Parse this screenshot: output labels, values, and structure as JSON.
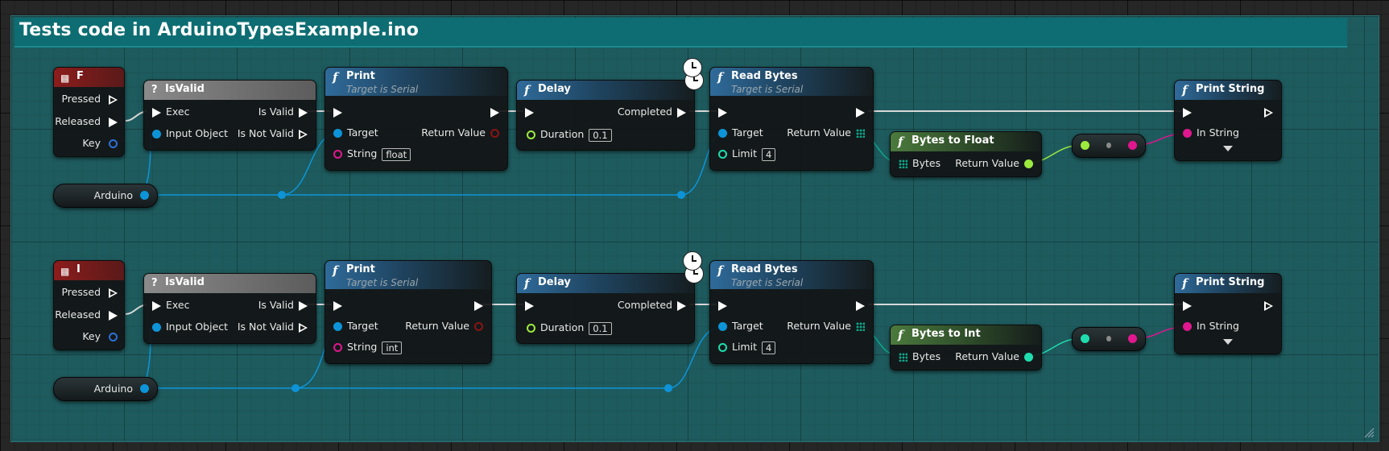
{
  "comment": {
    "title": "Tests code in ArduinoTypesExample.ino"
  },
  "rows": [
    {
      "event": {
        "title": "F",
        "pressed": "Pressed",
        "released": "Released",
        "key": "Key"
      },
      "isvalid": {
        "title": "IsValid",
        "exec": "Exec",
        "input_object": "Input Object",
        "is_valid": "Is Valid",
        "is_not_valid": "Is Not Valid"
      },
      "variable": {
        "name": "Arduino"
      },
      "print": {
        "title": "Print",
        "subtitle": "Target is Serial",
        "target": "Target",
        "return_value": "Return Value",
        "string_label": "String",
        "string_value": "float"
      },
      "delay": {
        "title": "Delay",
        "completed": "Completed",
        "duration_label": "Duration",
        "duration_value": "0.1"
      },
      "read_bytes": {
        "title": "Read Bytes",
        "subtitle": "Target is Serial",
        "target": "Target",
        "return_value": "Return Value",
        "limit_label": "Limit",
        "limit_value": "4"
      },
      "convert": {
        "title": "Bytes to Float",
        "bytes": "Bytes",
        "return_value": "Return Value",
        "type_color": "#9dea3f"
      },
      "print_string": {
        "title": "Print String",
        "in_string": "In String"
      }
    },
    {
      "event": {
        "title": "I",
        "pressed": "Pressed",
        "released": "Released",
        "key": "Key"
      },
      "isvalid": {
        "title": "IsValid",
        "exec": "Exec",
        "input_object": "Input Object",
        "is_valid": "Is Valid",
        "is_not_valid": "Is Not Valid"
      },
      "variable": {
        "name": "Arduino"
      },
      "print": {
        "title": "Print",
        "subtitle": "Target is Serial",
        "target": "Target",
        "return_value": "Return Value",
        "string_label": "String",
        "string_value": "int"
      },
      "delay": {
        "title": "Delay",
        "completed": "Completed",
        "duration_label": "Duration",
        "duration_value": "0.1"
      },
      "read_bytes": {
        "title": "Read Bytes",
        "subtitle": "Target is Serial",
        "target": "Target",
        "return_value": "Return Value",
        "limit_label": "Limit",
        "limit_value": "4"
      },
      "convert": {
        "title": "Bytes to Int",
        "bytes": "Bytes",
        "return_value": "Return Value",
        "type_color": "#1fddae"
      },
      "print_string": {
        "title": "Print String",
        "in_string": "In String"
      }
    }
  ],
  "colors": {
    "exec_wire": "#d8d8d8",
    "object_pin": "#0d94d8",
    "string_pin": "#e0178e",
    "float_pin": "#9dea3f",
    "int_pin": "#1fddae",
    "comment_header": "#0d6d72",
    "comment_body": "#1e5b5e"
  },
  "icons": {
    "function": "function-icon",
    "macro": "question-icon",
    "event": "keyboard-key-icon",
    "latent": "clock-icon",
    "resize": "resize-grip-icon"
  }
}
